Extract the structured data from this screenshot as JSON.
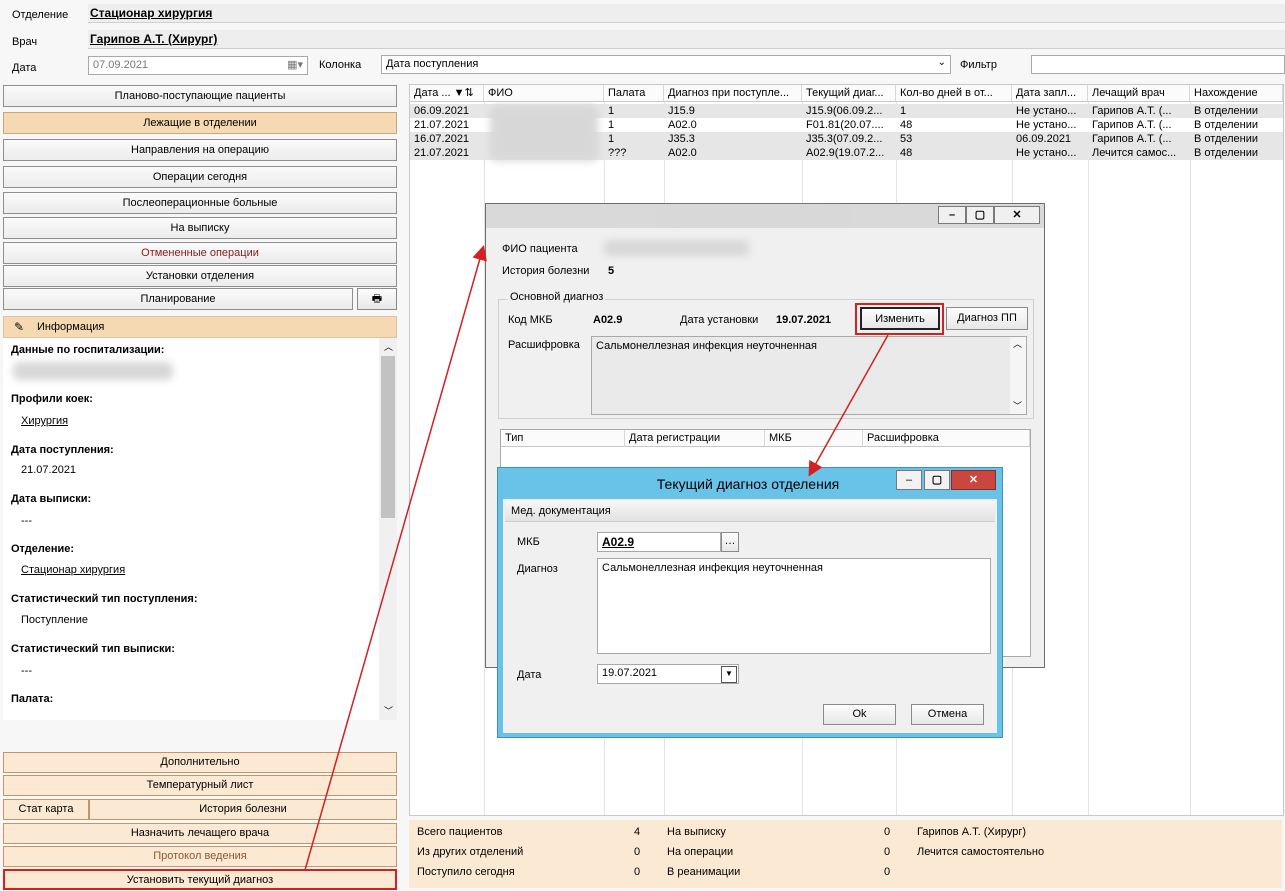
{
  "header": {
    "department_label": "Отделение",
    "department_value": "Стационар хирургия",
    "doctor_label": "Врач",
    "doctor_value": "Гарипов А.Т. (Хирург)",
    "date_label": "Дата",
    "date_value": "07.09.2021",
    "column_label": "Колонка",
    "column_value": "Дата поступления",
    "filter_label": "Фильтр",
    "filter_value": ""
  },
  "nav": {
    "items": [
      "Планово-поступающие пациенты",
      "Лежащие в отделении",
      "Направления на операцию",
      "Операции сегодня",
      "Послеоперационные больные",
      "На выписку",
      "Отмененные операции",
      "Установки отделения"
    ],
    "planning": "Планирование"
  },
  "info": {
    "title": "Информация",
    "hosp_label": "Данные по госпитализации:",
    "bed_profiles_label": "Профили коек:",
    "bed_profiles_value": "Хирургия",
    "admission_date_label": "Дата поступления:",
    "admission_date_value": "21.07.2021",
    "discharge_date_label": "Дата выписки:",
    "discharge_date_value": "---",
    "department_label": "Отделение:",
    "department_value": "Стационар хирургия",
    "stat_in_label": "Статистический тип поступления:",
    "stat_in_value": "Поступление",
    "stat_out_label": "Статистический тип выписки:",
    "stat_out_value": "---",
    "ward_label": "Палата:"
  },
  "bottom_buttons": {
    "additional": "Дополнительно",
    "temperature": "Температурный лист",
    "stat_card": "Стат карта",
    "history": "История болезни",
    "assign_doctor": "Назначить лечащего врача",
    "protocol": "Протокол ведения",
    "set_diagnosis": "Установить текущий диагноз"
  },
  "grid": {
    "columns": [
      "Дата ...",
      "ФИО",
      "Палата",
      "Диагноз при поступле...",
      "Текущий диаг...",
      "Кол-во дней в от...",
      "Дата запл...",
      "Лечащий врач",
      "Нахождение"
    ],
    "rows": [
      [
        "06.09.2021",
        "",
        "1",
        "J15.9",
        "J15.9(06.09.2...",
        "1",
        "Не устано...",
        "Гарипов А.Т. (...",
        "В отделении"
      ],
      [
        "21.07.2021",
        "",
        "1",
        "A02.0",
        "F01.81(20.07....",
        "48",
        "Не устано...",
        "Гарипов А.Т. (...",
        "В отделении"
      ],
      [
        "16.07.2021",
        "",
        "1",
        "J35.3",
        "J35.3(07.09.2...",
        "53",
        "06.09.2021",
        "Гарипов А.Т. (...",
        "В отделении"
      ],
      [
        "21.07.2021",
        "",
        "???",
        "A02.0",
        "A02.9(19.07.2...",
        "48",
        "Не устано...",
        "Лечится самос...",
        "В отделении"
      ]
    ]
  },
  "dialog1": {
    "fio_label": "ФИО пациента",
    "history_label": "История болезни",
    "history_value": "5",
    "group_label": "Основной диагноз",
    "mkb_label": "Код МКБ",
    "mkb_value": "A02.9",
    "set_date_label": "Дата установки",
    "set_date_value": "19.07.2021",
    "change_button": "Изменить",
    "pp_button": "Диагноз ПП",
    "decode_label": "Расшифровка",
    "decode_value": "Сальмонеллезная инфекция неуточненная",
    "table_columns": [
      "Тип",
      "Дата регистрации",
      "МКБ",
      "Расшифровка"
    ]
  },
  "dialog2": {
    "title": "Текущий диагноз отделения",
    "section": "Мед. документация",
    "mkb_label": "МКБ",
    "mkb_value": "A02.9",
    "diag_label": "Диагноз",
    "diag_value": "Сальмонеллезная инфекция неуточненная",
    "date_label": "Дата",
    "date_value": "19.07.2021",
    "ok": "Ok",
    "cancel": "Отмена"
  },
  "status": {
    "total_label": "Всего пациентов",
    "total_value": "4",
    "other_label": "Из других отделений",
    "other_value": "0",
    "today_label": "Поступило сегодня",
    "today_value": "0",
    "discharge_label": "На выписку",
    "discharge_value": "0",
    "operation_label": "На операции",
    "operation_value": "0",
    "icu_label": "В реанимации",
    "icu_value": "0",
    "doctor1": "Гарипов А.Т. (Хирург)",
    "doctor2": "Лечится самостоятельно"
  },
  "colors": {
    "accent_peach": "#fbe9d3",
    "highlight_red": "#d42020",
    "dialog_blue": "#69c3e8"
  }
}
